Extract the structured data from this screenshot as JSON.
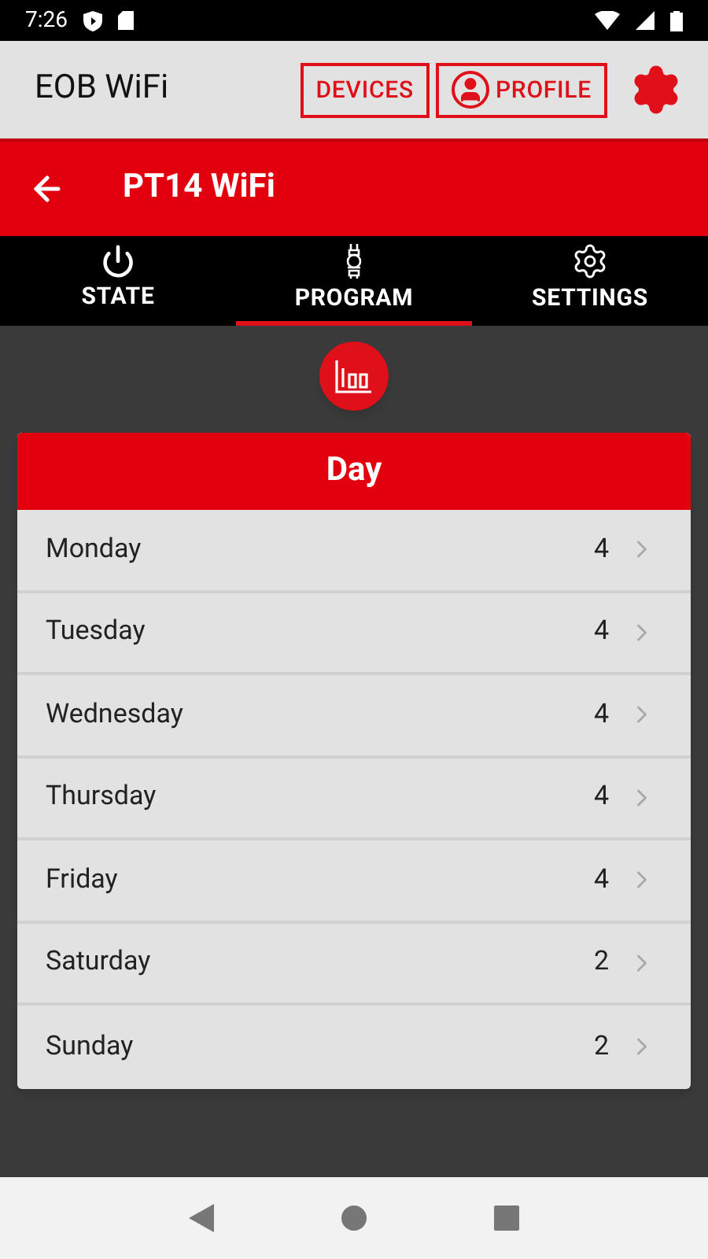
{
  "status_bar": {
    "time": "7:26"
  },
  "app_bar": {
    "title": "EOB WiFi",
    "buttons": [
      {
        "label": "DEVICES",
        "kind": "text"
      },
      {
        "label": "PROFILE",
        "kind": "profile"
      }
    ]
  },
  "device_header": {
    "title": "PT14 WiFi"
  },
  "tabs": [
    {
      "label": "STATE",
      "kind": "power",
      "selected": false
    },
    {
      "label": "PROGRAM",
      "kind": "program",
      "selected": true
    },
    {
      "label": "SETTINGS",
      "kind": "gear",
      "selected": false
    }
  ],
  "card": {
    "title": "Day",
    "rows": [
      {
        "day": "Monday",
        "count": "4"
      },
      {
        "day": "Tuesday",
        "count": "4"
      },
      {
        "day": "Wednesday",
        "count": "4"
      },
      {
        "day": "Thursday",
        "count": "4"
      },
      {
        "day": "Friday",
        "count": "4"
      },
      {
        "day": "Saturday",
        "count": "2"
      },
      {
        "day": "Sunday",
        "count": "2"
      }
    ]
  }
}
